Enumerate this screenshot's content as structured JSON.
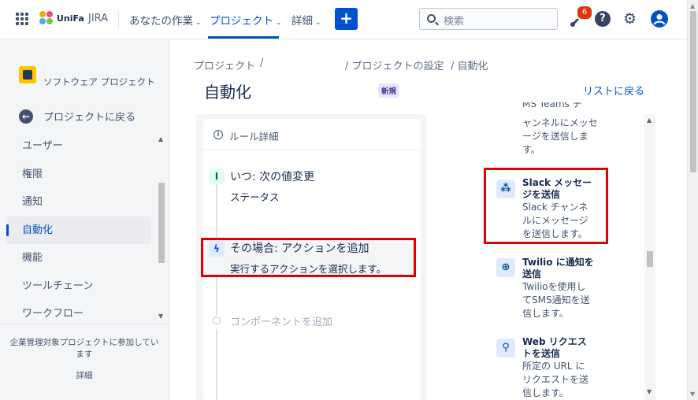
{
  "topnav": {
    "logo_text": "UniFa",
    "product": "JIRA",
    "nav_items": [
      {
        "label": "あなたの作業"
      },
      {
        "label": "プロジェクト"
      },
      {
        "label": "詳細"
      }
    ],
    "create_label": "+",
    "search_placeholder": "検索",
    "notifications_count": "6",
    "help_label": "?"
  },
  "sidebar": {
    "project_name": "ソフトウェア プロジェクト",
    "back_label": "プロジェクトに戻る",
    "items": [
      {
        "label": "ユーザー"
      },
      {
        "label": "権限"
      },
      {
        "label": "通知"
      },
      {
        "label": "自動化"
      },
      {
        "label": "機能"
      },
      {
        "label": "ツールチェーン"
      },
      {
        "label": "ワークフロー"
      }
    ],
    "active_item": "自動化",
    "footer_text": "企業管理対象プロジェクトに参加しています",
    "footer_link": "詳細"
  },
  "breadcrumb": {
    "part1": "プロジェクト",
    "sep": "/",
    "part2": "/ プロジェクトの設定",
    "part3": "/ 自動化"
  },
  "page": {
    "title": "自動化",
    "badge": "新規",
    "back_link": "リストに戻る"
  },
  "rule": {
    "header": "ルール詳細",
    "trigger_title": "いつ: 次の値変更",
    "trigger_sub": "ステータス",
    "action_title": "その場合: アクションを追加",
    "action_sub": "実行するアクションを選択します。",
    "add_component": "コンポーネントを追加"
  },
  "picker": {
    "teams_cut_title": "MS Teams チ",
    "teams_cut_lines": [
      "ャンネルにメッセ",
      "ージを送信しま",
      "す。"
    ],
    "items": [
      {
        "title_lines": [
          "Slack メッセー",
          "ジを送信"
        ],
        "desc_lines": [
          "Slack チャンネ",
          "ルにメッセージ",
          "を送信します。"
        ]
      },
      {
        "title_lines": [
          "Twilio に通知を",
          "送信"
        ],
        "desc_lines": [
          "Twilioを使用し",
          "てSMS通知を送",
          "信します。"
        ]
      },
      {
        "title_lines": [
          "Web リクエス",
          "トを送信"
        ],
        "desc_lines": [
          "所定の URL に",
          "リクエストを送",
          "信します。"
        ]
      }
    ]
  },
  "colors": {
    "primary": "#0052cc",
    "highlight_border": "#e00000",
    "badge_bg": "#eae6ff",
    "notify_badge": "#de350b"
  }
}
